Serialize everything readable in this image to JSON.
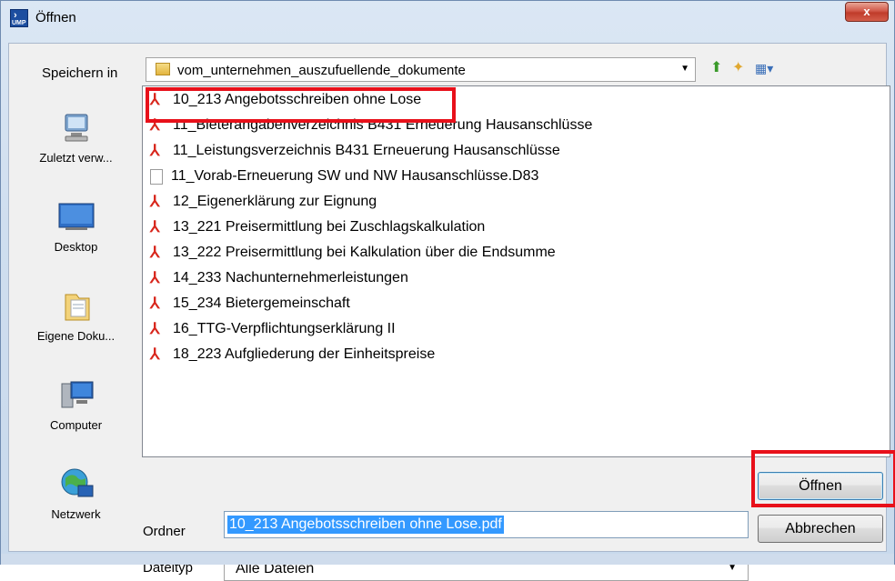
{
  "window": {
    "title": "Öffnen",
    "app_icon_label": "UMP",
    "close_label": "x"
  },
  "location": {
    "label": "Speichern in",
    "current_folder": "vom_unternehmen_auszufuellende_dokumente"
  },
  "toolbar": {
    "up_icon": "folder-up-icon",
    "new_folder_icon": "new-folder-icon",
    "view_icon": "view-menu-icon"
  },
  "places": [
    {
      "name": "recent",
      "label": "Zuletzt verw...",
      "icon": "recent-places-icon"
    },
    {
      "name": "desktop",
      "label": "Desktop",
      "icon": "desktop-icon"
    },
    {
      "name": "documents",
      "label": "Eigene Doku...",
      "icon": "documents-folder-icon"
    },
    {
      "name": "computer",
      "label": "Computer",
      "icon": "computer-icon"
    },
    {
      "name": "network",
      "label": "Netzwerk",
      "icon": "network-globe-icon"
    }
  ],
  "files": [
    {
      "name": "10_213 Angebotsschreiben ohne Lose",
      "type": "pdf"
    },
    {
      "name": "11_Bieterangabenverzeichnis B431 Erneuerung Hausanschlüsse",
      "type": "pdf"
    },
    {
      "name": "11_Leistungsverzeichnis B431 Erneuerung Hausanschlüsse",
      "type": "pdf"
    },
    {
      "name": "11_Vorab-Erneuerung SW und NW Hausanschlüsse.D83",
      "type": "generic"
    },
    {
      "name": "12_Eigenerklärung zur Eignung",
      "type": "pdf"
    },
    {
      "name": "13_221 Preisermittlung bei Zuschlagskalkulation",
      "type": "pdf"
    },
    {
      "name": "13_222 Preisermittlung bei Kalkulation über die Endsumme",
      "type": "pdf"
    },
    {
      "name": "14_233 Nachunternehmerleistungen",
      "type": "pdf"
    },
    {
      "name": "15_234 Bietergemeinschaft",
      "type": "pdf"
    },
    {
      "name": "16_TTG-Verpflichtungserklärung II",
      "type": "pdf"
    },
    {
      "name": "18_223 Aufgliederung der Einheitspreise",
      "type": "pdf"
    }
  ],
  "form": {
    "ordner_label": "Ordner",
    "ordner_value": "10_213 Angebotsschreiben ohne Lose.pdf",
    "dateityp_label": "Dateityp",
    "dateityp_value": "Alle Dateien"
  },
  "buttons": {
    "open": "Öffnen",
    "cancel": "Abbrechen"
  },
  "colors": {
    "highlight": "#e8101a",
    "selection": "#3399ff",
    "pdf_icon": "#d8261c"
  }
}
